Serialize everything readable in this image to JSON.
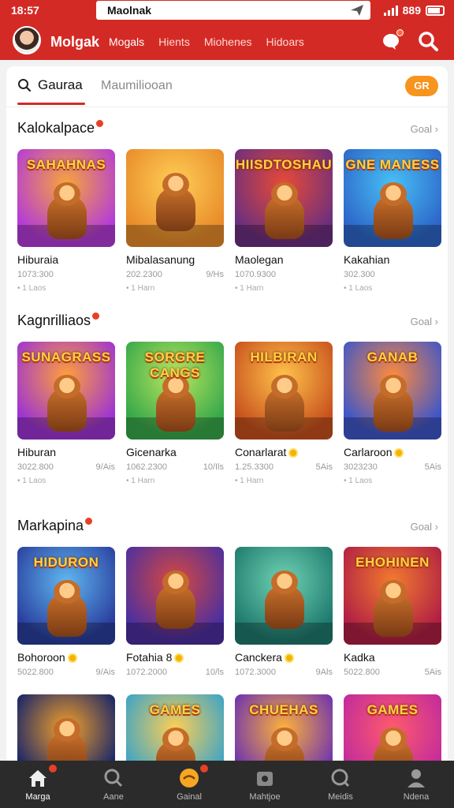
{
  "status_bar": {
    "time": "18:57",
    "url": "Maolnak",
    "battery": "889"
  },
  "app_bar": {
    "brand": "Molgak",
    "nav": [
      "Mogals",
      "Hients",
      "Miohenes",
      "Hidoars"
    ]
  },
  "tabs": {
    "active": "Gauraa",
    "inactive": "Maumiliooan",
    "pill": "GR"
  },
  "sections": [
    {
      "title": "Kalokalpace",
      "see_all": "Goal ›",
      "games": [
        {
          "art": "SAHAHNAS",
          "name": "Hiburaia",
          "stat": "1073:300",
          "right": "",
          "sub": "• 1 Laos",
          "coin": false,
          "theme": [
            "#b43bd8",
            "#f7a53b"
          ]
        },
        {
          "art": "",
          "name": "Mibalasanung",
          "stat": "202.2300",
          "right": "9/Hs",
          "sub": "• 1 Harn",
          "coin": false,
          "theme": [
            "#e88b2a",
            "#ffcf55"
          ]
        },
        {
          "art": "HIISDTOSHAU",
          "name": "Maolegan",
          "stat": "1070.9300",
          "right": "",
          "sub": "• 1 Harn",
          "coin": false,
          "theme": [
            "#6b2f7e",
            "#e84a36"
          ]
        },
        {
          "art": "GNE MANESS",
          "name": "Kakahian",
          "stat": "302.300",
          "right": "",
          "sub": "• 1 Laos",
          "coin": false,
          "theme": [
            "#2d66c9",
            "#47c0f5"
          ]
        }
      ]
    },
    {
      "title": "Kagnrilliaos",
      "see_all": "Goal ›",
      "games": [
        {
          "art": "SUNAGRASS",
          "name": "Hiburan",
          "stat": "3022.800",
          "right": "9/Ais",
          "sub": "• 1 Laos",
          "coin": false,
          "theme": [
            "#9d34d3",
            "#ff9f3b"
          ]
        },
        {
          "art": "SORGRE CANGS",
          "name": "Gicenarka",
          "stat": "1062.2300",
          "right": "10/Ils",
          "sub": "• 1 Harn",
          "coin": false,
          "theme": [
            "#36a84a",
            "#bde65f"
          ]
        },
        {
          "art": "HILBIRAN",
          "name": "Conarlarat",
          "stat": "1.25.3300",
          "right": "5Ais",
          "sub": "• 1 Harn",
          "coin": true,
          "theme": [
            "#c8511e",
            "#ffc34a"
          ]
        },
        {
          "art": "GANAB",
          "name": "Carlaroon",
          "stat": "3023230",
          "right": "5Ais",
          "sub": "• 1 Laos",
          "coin": true,
          "theme": [
            "#3f56c9",
            "#ff8b3c"
          ]
        }
      ]
    },
    {
      "title": "Markapina",
      "see_all": "Goal ›",
      "games": [
        {
          "art": "HIDURON",
          "name": "Bohoroon",
          "stat": "5022.800",
          "right": "9/Ais",
          "sub": "",
          "coin": true,
          "theme": [
            "#2a3f9e",
            "#5fb7f0"
          ]
        },
        {
          "art": "",
          "name": "Fotahia 8",
          "stat": "1072.2000",
          "right": "10/ls",
          "sub": "",
          "coin": true,
          "theme": [
            "#4b2fa0",
            "#d8483f"
          ]
        },
        {
          "art": "",
          "name": "Canckera",
          "stat": "1072.3000",
          "right": "9Als",
          "sub": "",
          "coin": true,
          "theme": [
            "#1f7a6e",
            "#6fd3b4"
          ]
        },
        {
          "art": "EHOHINEN",
          "name": "Kadka",
          "stat": "5022.800",
          "right": "5Ais",
          "sub": "",
          "coin": false,
          "theme": [
            "#b11f44",
            "#f27b2e"
          ]
        }
      ]
    },
    {
      "title": "",
      "see_all": "",
      "games": [
        {
          "art": "",
          "name": "",
          "stat": "",
          "right": "",
          "sub": "",
          "coin": false,
          "theme": [
            "#10216a",
            "#f4a12a"
          ]
        },
        {
          "art": "GAMES",
          "name": "",
          "stat": "",
          "right": "",
          "sub": "",
          "coin": false,
          "theme": [
            "#37a3c9",
            "#ffcf55"
          ]
        },
        {
          "art": "CHUEHAS",
          "name": "",
          "stat": "",
          "right": "",
          "sub": "",
          "coin": false,
          "theme": [
            "#6a2fb2",
            "#ffb23a"
          ]
        },
        {
          "art": "GAMES",
          "name": "",
          "stat": "",
          "right": "",
          "sub": "",
          "coin": false,
          "theme": [
            "#c02a9d",
            "#ff5a6c"
          ]
        }
      ]
    }
  ],
  "bottom_nav": [
    {
      "label": "Marga",
      "icon": "home-icon",
      "active": true,
      "badge": true
    },
    {
      "label": "Aane",
      "icon": "search-icon",
      "active": false,
      "badge": false
    },
    {
      "label": "Gainal",
      "icon": "game-icon",
      "active": false,
      "badge": true
    },
    {
      "label": "Mahtjoe",
      "icon": "store-icon",
      "active": false,
      "badge": false
    },
    {
      "label": "Meidis",
      "icon": "discover-icon",
      "active": false,
      "badge": false
    },
    {
      "label": "Ndena",
      "icon": "profile-icon",
      "active": false,
      "badge": false
    }
  ],
  "colors": {
    "brand_red": "#d42a25",
    "accent_orange": "#f7941d",
    "bottom_bg": "#2b2b2b"
  }
}
